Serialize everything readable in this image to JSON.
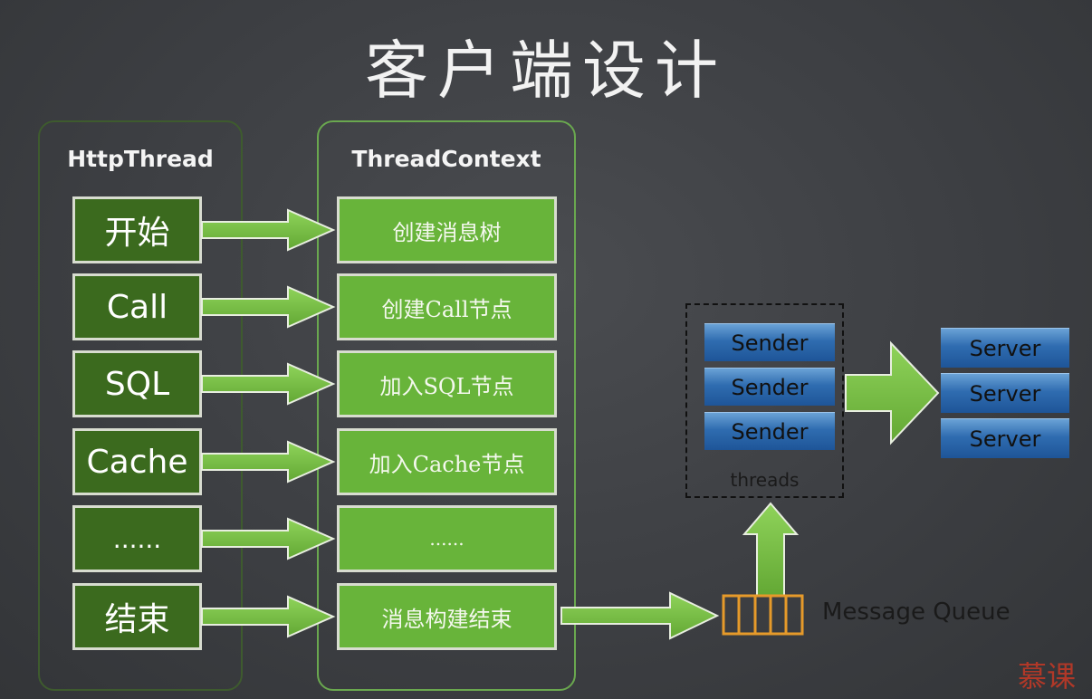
{
  "title": "客户端设计",
  "http_thread": {
    "title": "HttpThread",
    "items": [
      "开始",
      "Call",
      "SQL",
      "Cache",
      "......",
      "结束"
    ]
  },
  "thread_context": {
    "title": "ThreadContext",
    "items": [
      "创建消息树",
      "创建Call节点",
      "加入SQL节点",
      "加入Cache节点",
      "......",
      "消息构建结束"
    ]
  },
  "senders": [
    "Sender",
    "Sender",
    "Sender"
  ],
  "threads_label": "threads",
  "servers": [
    "Server",
    "Server",
    "Server"
  ],
  "queue_label": "Message Queue",
  "watermark": "慕课",
  "colors": {
    "http_box": "#3b6a1e",
    "ctx_box": "#68b43a",
    "arrow": "#7dc24a",
    "sender": "#2f6cb0",
    "queue": "#e69a2a"
  }
}
